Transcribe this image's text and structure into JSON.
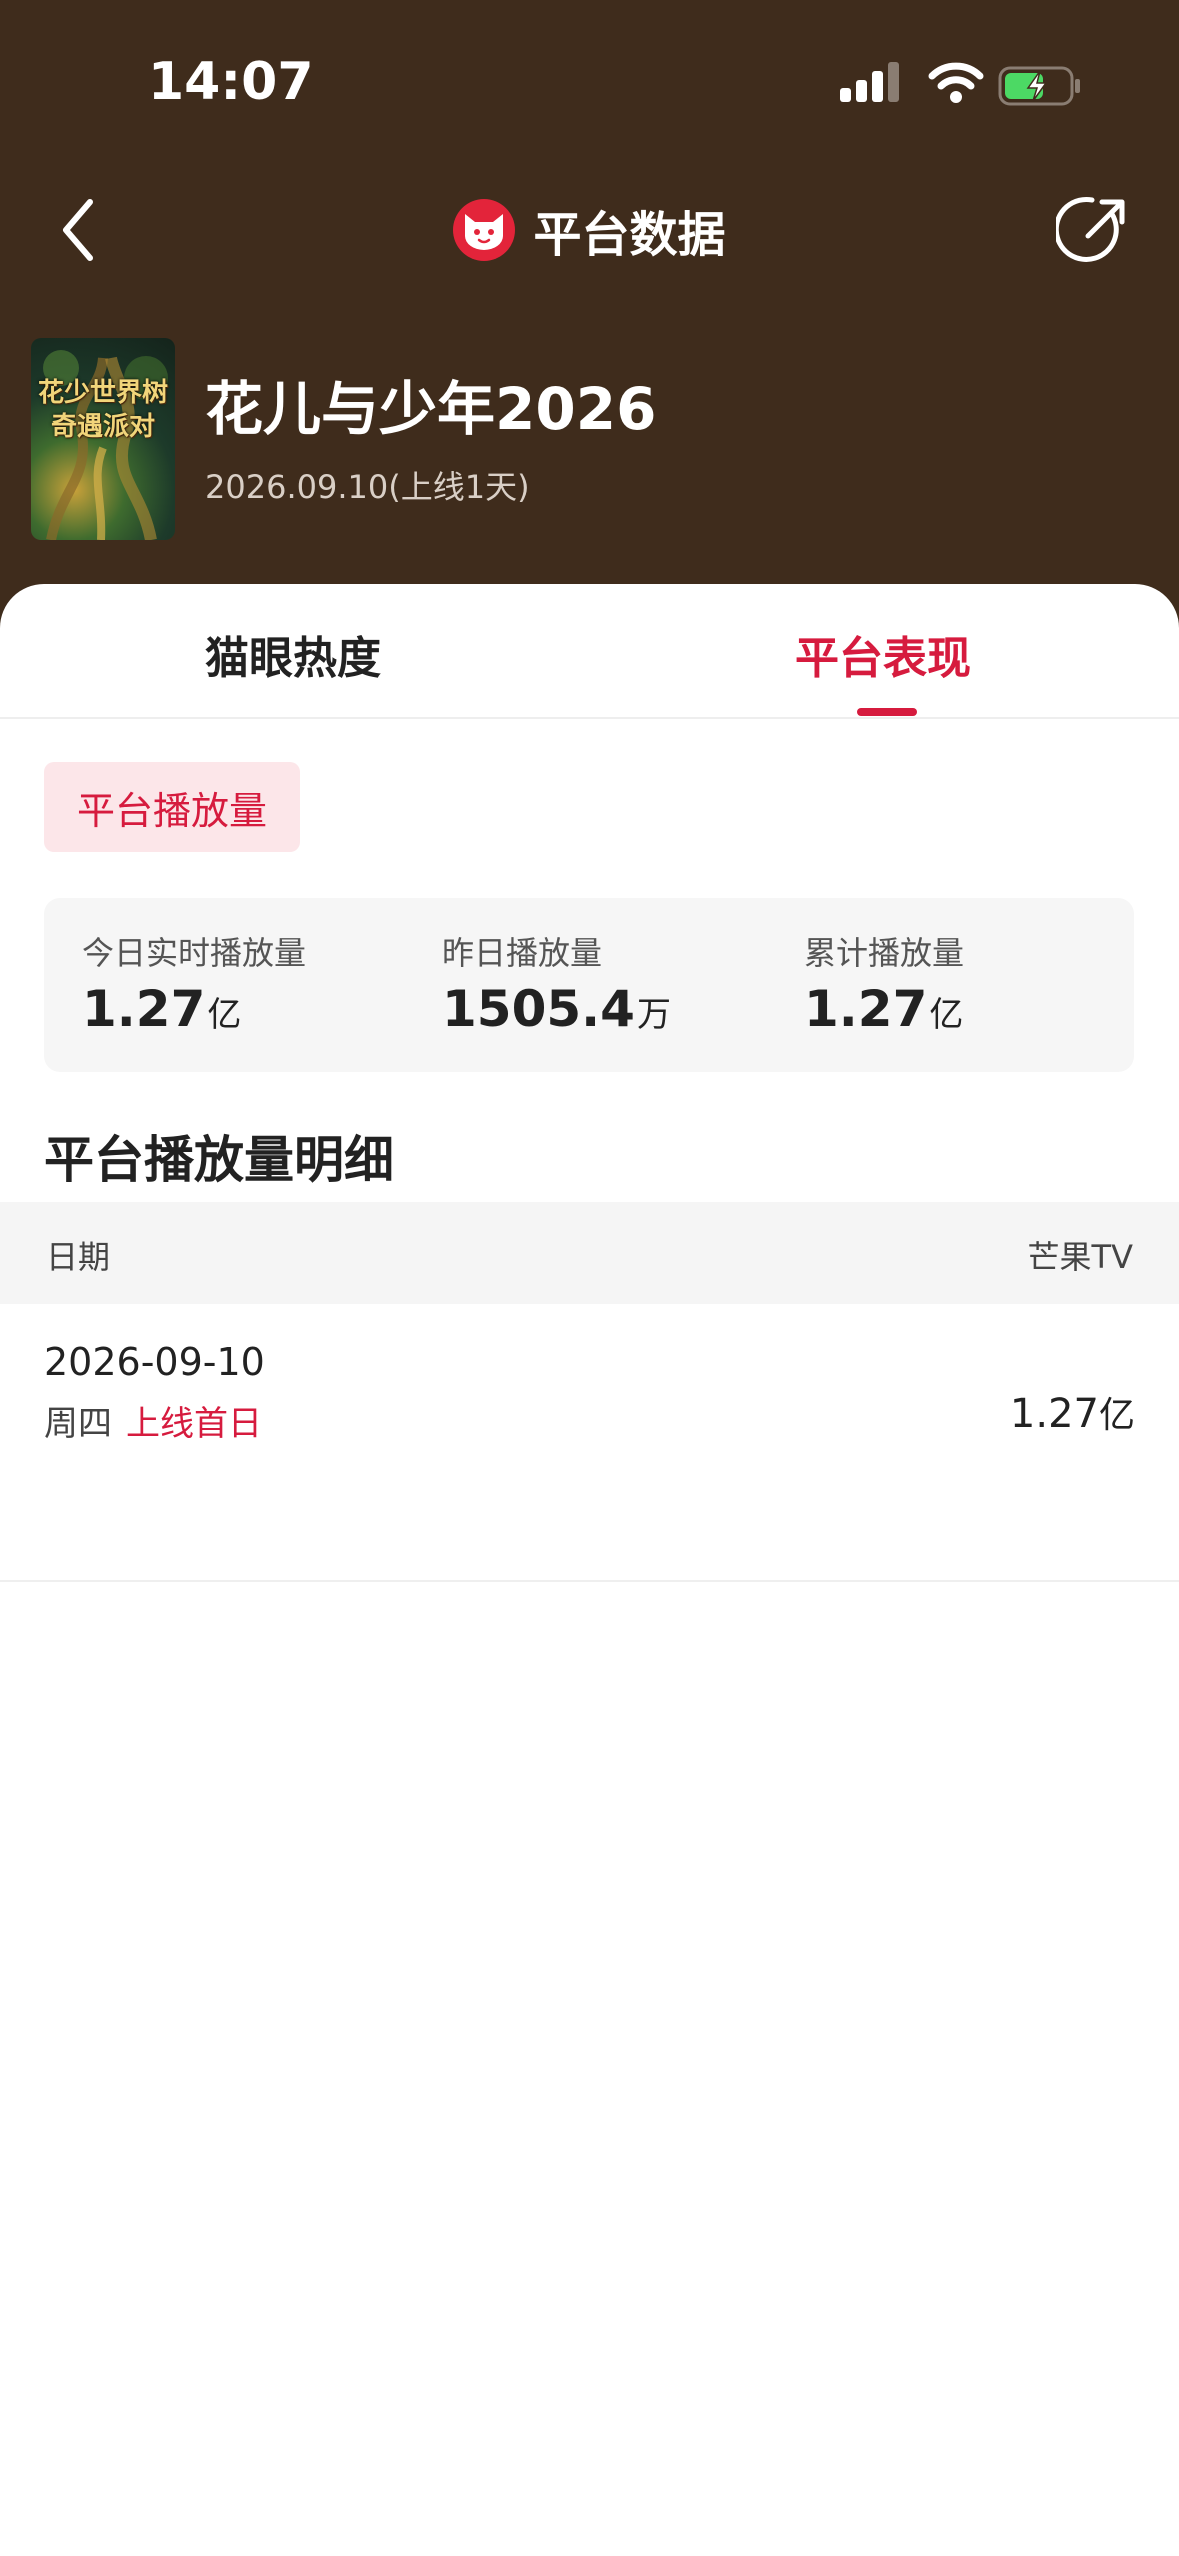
{
  "status_bar": {
    "time": "14:07"
  },
  "nav": {
    "title": "平台数据"
  },
  "show": {
    "title": "花儿与少年2026",
    "date": "2026.09.10(上线1天)",
    "poster_text_line1": "花少世界树",
    "poster_text_line2": "奇遇派对"
  },
  "tabs": [
    {
      "label": "猫眼热度",
      "active": false
    },
    {
      "label": "平台表现",
      "active": true
    }
  ],
  "chip": {
    "label": "平台播放量"
  },
  "stats": [
    {
      "label": "今日实时播放量",
      "value": "1.27",
      "unit": "亿"
    },
    {
      "label": "昨日播放量",
      "value": "1505.4",
      "unit": "万"
    },
    {
      "label": "累计播放量",
      "value": "1.27",
      "unit": "亿"
    }
  ],
  "detail": {
    "title": "平台播放量明细",
    "columns": {
      "date": "日期",
      "platform": "芒果TV"
    },
    "rows": [
      {
        "date": "2026-09-10",
        "weekday": "周四",
        "tag": "上线首日",
        "value": "1.27",
        "unit": "亿"
      }
    ]
  },
  "colors": {
    "header_bg": "#3f2c1c",
    "accent": "#d61b3e",
    "chip_bg": "#fce6e9",
    "stats_bg": "#f6f6f6"
  },
  "icons": [
    "back-chevron-icon",
    "maoyan-cat-logo-icon",
    "share-icon",
    "signal-icon",
    "wifi-icon",
    "battery-charging-icon"
  ]
}
